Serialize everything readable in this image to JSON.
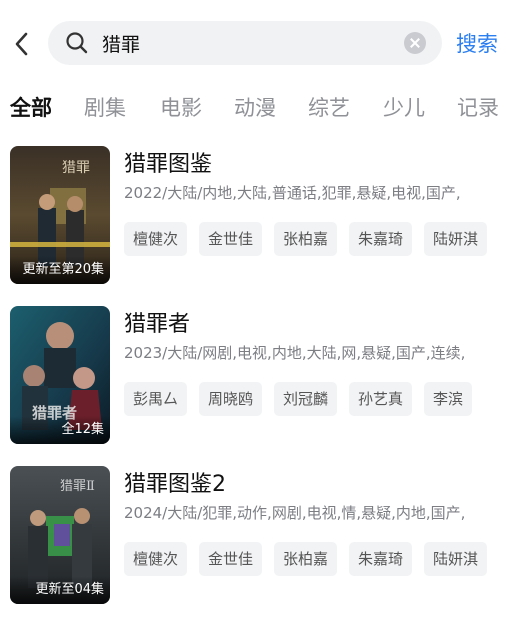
{
  "header": {
    "query": "猎罪",
    "search_label": "搜索",
    "icons": {
      "back": "chevron-left-icon",
      "search": "search-icon",
      "clear": "clear-icon"
    }
  },
  "tabs": [
    {
      "label": "全部",
      "active": true
    },
    {
      "label": "剧集"
    },
    {
      "label": "电影"
    },
    {
      "label": "动漫"
    },
    {
      "label": "综艺"
    },
    {
      "label": "少儿"
    },
    {
      "label": "记录"
    }
  ],
  "results": [
    {
      "title": "猎罪图鉴",
      "meta": "2022/大陆/内地,大陆,普通话,犯罪,悬疑,电视,国产,",
      "badge": "更新至第20集",
      "cast": [
        "檀健次",
        "金世佳",
        "张柏嘉",
        "朱嘉琦",
        "陆妍淇"
      ]
    },
    {
      "title": "猎罪者",
      "meta": "2023/大陆/网剧,电视,内地,大陆,网,悬疑,国产,连续,",
      "badge": "全12集",
      "cast": [
        "彭禺厶",
        "周晓鸥",
        "刘冠麟",
        "孙艺真",
        "李滨"
      ]
    },
    {
      "title": "猎罪图鉴2",
      "meta": "2024/大陆/犯罪,动作,网剧,电视,情,悬疑,内地,国产,",
      "badge": "更新至04集",
      "cast": [
        "檀健次",
        "金世佳",
        "张柏嘉",
        "朱嘉琦",
        "陆妍淇"
      ]
    }
  ],
  "colors": {
    "accent": "#2a7ef0",
    "chip_bg": "#f2f3f5"
  }
}
